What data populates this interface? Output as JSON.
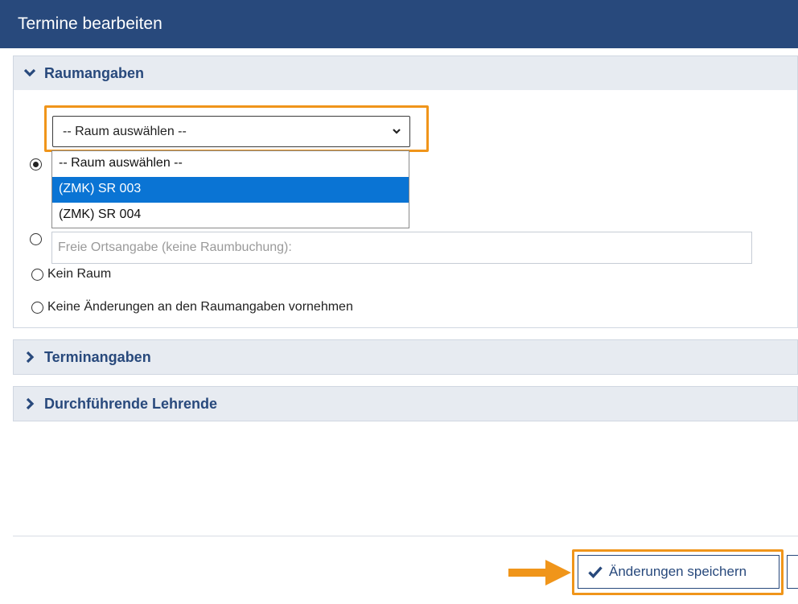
{
  "header": {
    "title": "Termine bearbeiten"
  },
  "sections": {
    "raum": {
      "label": "Raumangaben",
      "expanded": true
    },
    "termin": {
      "label": "Terminangaben",
      "expanded": false
    },
    "lehrende": {
      "label": "Durchführende Lehrende",
      "expanded": false
    }
  },
  "room_select": {
    "value": "-- Raum auswählen --",
    "options": [
      "-- Raum auswählen --",
      "(ZMK) SR 003",
      "(ZMK) SR 004"
    ],
    "highlighted_option": "(ZMK) SR 003"
  },
  "free_location": {
    "placeholder": "Freie Ortsangabe (keine Raumbuchung):"
  },
  "radio_options": {
    "no_room": "Kein Raum",
    "no_changes": "Keine Änderungen an den Raumangaben vornehmen"
  },
  "footer": {
    "save_label": "Änderungen speichern"
  },
  "colors": {
    "primary": "#28497c",
    "accent": "#f0951a",
    "selected": "#0a74d4",
    "section_bg": "#e7ebf1"
  }
}
